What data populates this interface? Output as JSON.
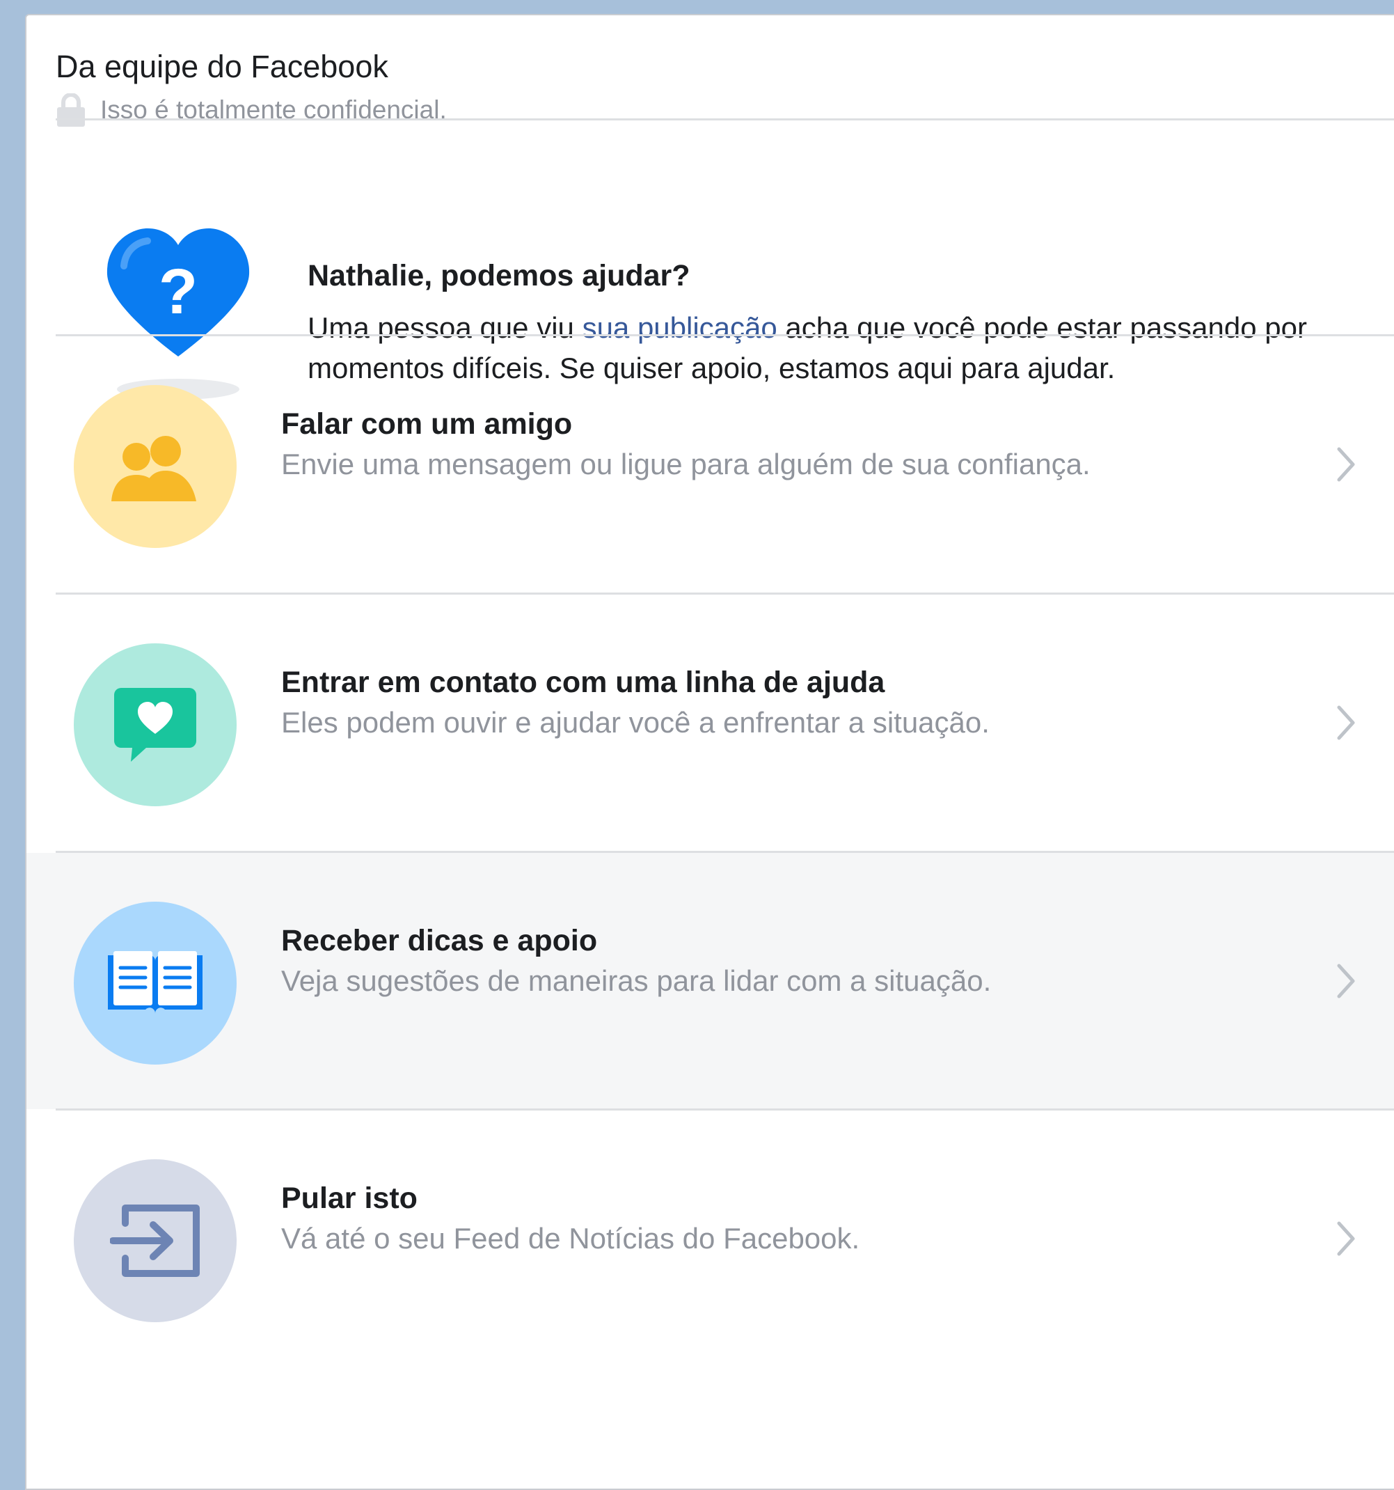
{
  "header": {
    "title": "Da equipe do Facebook",
    "subtitle": "Isso é totalmente confidencial.",
    "icon": "lock-icon"
  },
  "intro": {
    "icon": "heart-question-icon",
    "title": "Nathalie, podemos ajudar?",
    "body_before": "Uma pessoa que viu ",
    "body_link": "sua publicação",
    "body_after": " acha que você pode estar passando por momentos difíceis. Se quiser apoio, estamos aqui para ajudar."
  },
  "options": [
    {
      "title": "Falar com um amigo",
      "description": "Envie uma mensagem ou ligue para alguém de sua confiança.",
      "icon": "friends-icon",
      "circle_color": "#ffe8a8",
      "icon_color": "#f7b928"
    },
    {
      "title": "Entrar em contato com uma linha de ajuda",
      "description": "Eles podem ouvir e ajudar você a enfrentar a situação.",
      "icon": "chat-heart-icon",
      "circle_color": "#aeeade",
      "icon_color": "#19c59d"
    },
    {
      "title": "Receber dicas e apoio",
      "description": "Veja sugestões de maneiras para lidar com a situação.",
      "icon": "book-icon",
      "circle_color": "#aad8fd",
      "icon_color": "#0a7cf1",
      "hovered": true
    },
    {
      "title": "Pular isto",
      "description": "Vá até o seu Feed de Notícias do Facebook.",
      "icon": "exit-arrow-icon",
      "circle_color": "#d6dbe8",
      "icon_color": "#6d84b4"
    }
  ],
  "colors": {
    "page_background": "#a7c0da",
    "link": "#365899",
    "secondary_text": "#90949c",
    "hover_row": "#f5f6f7"
  }
}
